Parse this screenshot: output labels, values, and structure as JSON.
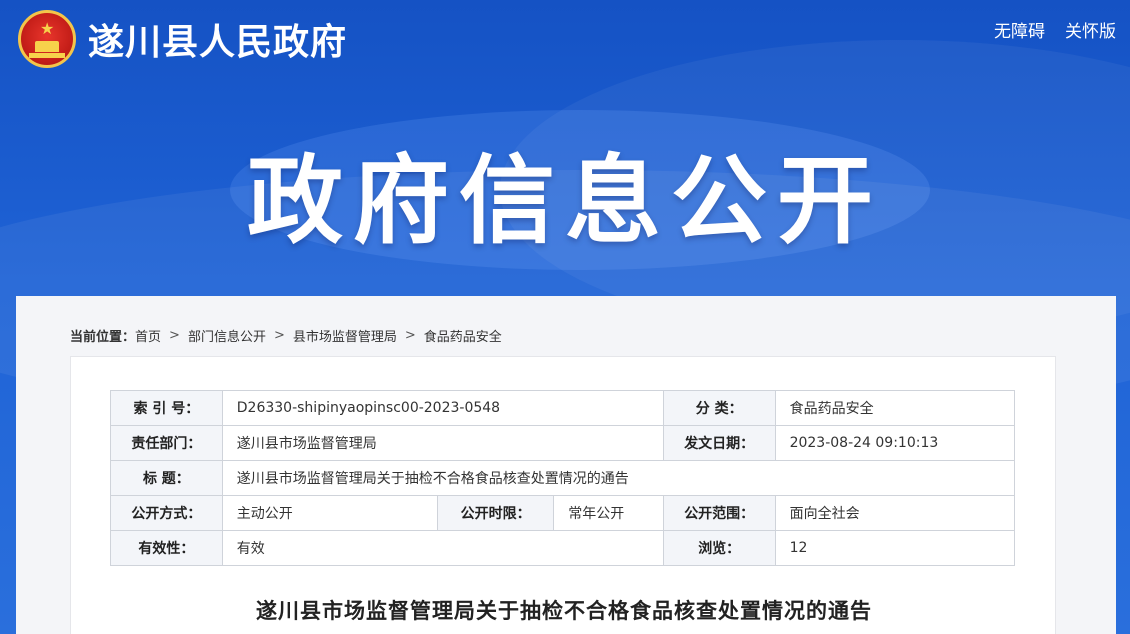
{
  "header": {
    "site_title": "遂川县人民政府",
    "links": [
      "无障碍",
      "关怀版"
    ],
    "emblem_icon": "national-emblem-icon"
  },
  "banner": {
    "heading": "政府信息公开"
  },
  "breadcrumb": {
    "label": "当前位置：",
    "items": [
      "首页",
      "部门信息公开",
      "县市场监督管理局",
      "食品药品安全"
    ],
    "separator": ">"
  },
  "meta": {
    "index_key": "索 引 号：",
    "index_val": "D26330-shipinyaopinsc00-2023-0548",
    "category_key": "分 类：",
    "category_val": "食品药品安全",
    "dept_key": "责任部门：",
    "dept_val": "遂川县市场监督管理局",
    "date_key": "发文日期：",
    "date_val": "2023-08-24 09:10:13",
    "title_key": "标 题：",
    "title_val": "遂川县市场监督管理局关于抽检不合格食品核查处置情况的通告",
    "method_key": "公开方式：",
    "method_val": "主动公开",
    "period_key": "公开时限：",
    "period_val": "常年公开",
    "scope_key": "公开范围：",
    "scope_val": "面向全社会",
    "validity_key": "有效性：",
    "validity_val": "有效",
    "views_key": "浏览：",
    "views_val": "12"
  },
  "document": {
    "title": "遂川县市场监督管理局关于抽检不合格食品核查处置情况的通告"
  },
  "colors": {
    "banner_blue": "#1a57c8",
    "panel_bg": "#f4f5f8",
    "table_key_bg": "#f3f5f9",
    "table_border": "#cfd3da"
  }
}
